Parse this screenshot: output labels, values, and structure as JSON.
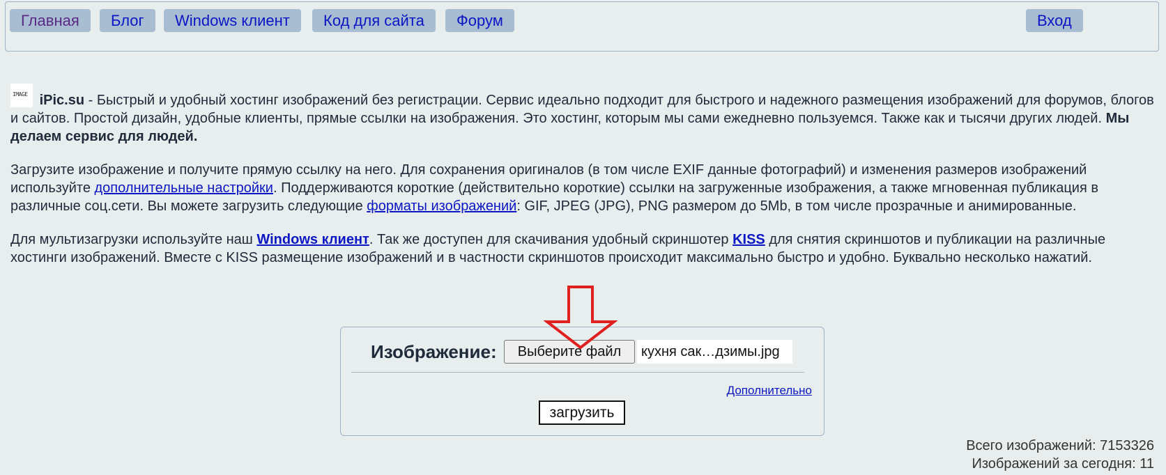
{
  "nav": {
    "home": "Главная",
    "blog": "Блог",
    "windows_client": "Windows клиент",
    "site_code": "Код для сайта",
    "forum": "Форум",
    "login": "Вход"
  },
  "logo": {
    "line1": "IMAGE"
  },
  "intro": {
    "brand": "iPic.su",
    "text": " - Быстрый и удобный хостинг изображений без регистрации. Сервис идеально подходит для быстрого и надежного размещения изображений для форумов, блогов и сайтов. Простой дизайн, удобные клиенты, прямые ссылки на изображения. Это хостинг, которым мы сами ежедневно пользуемся. Также как и тысячи других людей. ",
    "bold": "Мы делаем сервис для людей."
  },
  "upload_info": {
    "part1": "Загрузите изображение и получите прямую ссылку на него. Для сохранения оригиналов (в том числе EXIF данные фотографий) и изменения размеров изображений используйте ",
    "link_settings": "дополнительные настройки",
    "part2": ". Поддерживаются короткие (действительно короткие) ссылки на загруженные изображения, а также мгновенная публикация в различные соц.сети. Вы можете загрузить следующие ",
    "link_formats": "форматы изображений",
    "part3": ": GIF, JPEG (JPG), PNG размером до 5Mb, в том числе прозрачные и анимированные."
  },
  "multi_info": {
    "part1": "Для мультизагрузки используйте наш ",
    "link_windows": "Windows клиент",
    "part2": ". Так же доступен для скачивания удобный скриншотер ",
    "link_kiss": "KISS",
    "part3": " для снятия скриншотов и публикации на различные хостинги изображений. Вместе с KISS размещение изображений и в частности скриншотов происходит максимально быстро и удобно. Буквально несколько нажатий."
  },
  "upload_form": {
    "label": "Изображение:",
    "choose_file": "Выберите файл",
    "file_name": "кухня сак…дзимы.jpg",
    "more": "Дополнительно",
    "submit": "загрузить"
  },
  "stats": {
    "total": "Всего изображений: 7153326",
    "today": "Изображений за сегодня: 11"
  },
  "colors": {
    "background": "#e8eeee",
    "nav_button": "#a8bcd2",
    "link": "#0b16c4",
    "arrow": "#e02020"
  },
  "icons": {
    "arrow": "down-arrow-icon"
  }
}
